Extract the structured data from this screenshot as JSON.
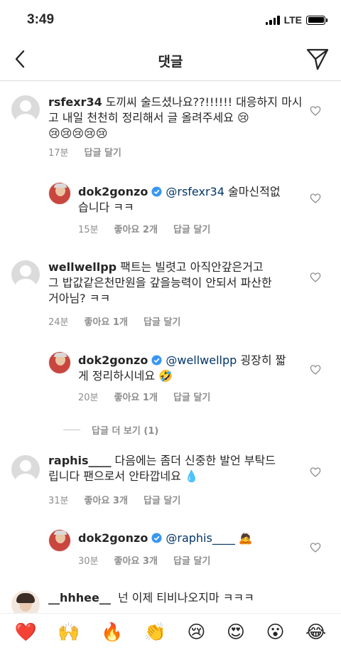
{
  "status": {
    "time": "3:49",
    "network": "LTE"
  },
  "header": {
    "title": "댓글"
  },
  "comments": [
    {
      "username": "rsfexr34",
      "text": "도끼씨 술드셨나요??!!!!!! 대응하지 마시고 내일 천천히 정리해서 글 올려주세요 😢",
      "text2": "😢😢😢😢😢",
      "time": "17분",
      "reply_label": "답글 달기"
    },
    {
      "username": "dok2gonzo",
      "mention": "@rsfexr34",
      "text": "술마신적없",
      "text2": "습니다 ㅋㅋ",
      "time": "15분",
      "likes": "좋아요 2개",
      "reply_label": "답글 달기"
    },
    {
      "username": "wellwellpp",
      "text": "팩트는 빌렷고 아직안갚은거고",
      "text2": "그 밥값같은천만원을 갚을능력이 안되서 파산한",
      "text3": "거아님? ㅋㅋ",
      "time": "24분",
      "likes": "좋아요 1개",
      "reply_label": "답글 달기"
    },
    {
      "username": "dok2gonzo",
      "mention": "@wellwellpp",
      "text": "굉장히 짧",
      "text2": "게 정리하시네요 🤣",
      "time": "20분",
      "likes": "좋아요 1개",
      "reply_label": "답글 달기"
    },
    {
      "username": "raphis____",
      "text": "다음에는 좀더 신중한 발언 부탁드",
      "text2": "립니다 팬으로서 안타깝네요 💧",
      "time": "31분",
      "likes": "좋아요 3개",
      "reply_label": "답글 달기"
    },
    {
      "username": "dok2gonzo",
      "mention": "@raphis____",
      "text": "🙇",
      "time": "30분",
      "likes": "좋아요 3개",
      "reply_label": "답글 달기"
    },
    {
      "username": "__hhhee__",
      "text": "넌 이제 티비나오지마 ㅋㅋㅋ"
    }
  ],
  "view_more_replies": "답글 더 보기 (1)",
  "emoji_bar": [
    "❤️",
    "🙌",
    "🔥",
    "👏",
    "😢",
    "😍",
    "😮",
    "😂"
  ],
  "colors": {
    "mention": "#003569",
    "verified": "#3897f0",
    "meta": "#8e8e8e"
  },
  "icons": [
    "back-arrow-icon",
    "send-direct-icon",
    "heart-outline-icon",
    "verified-badge-icon"
  ]
}
